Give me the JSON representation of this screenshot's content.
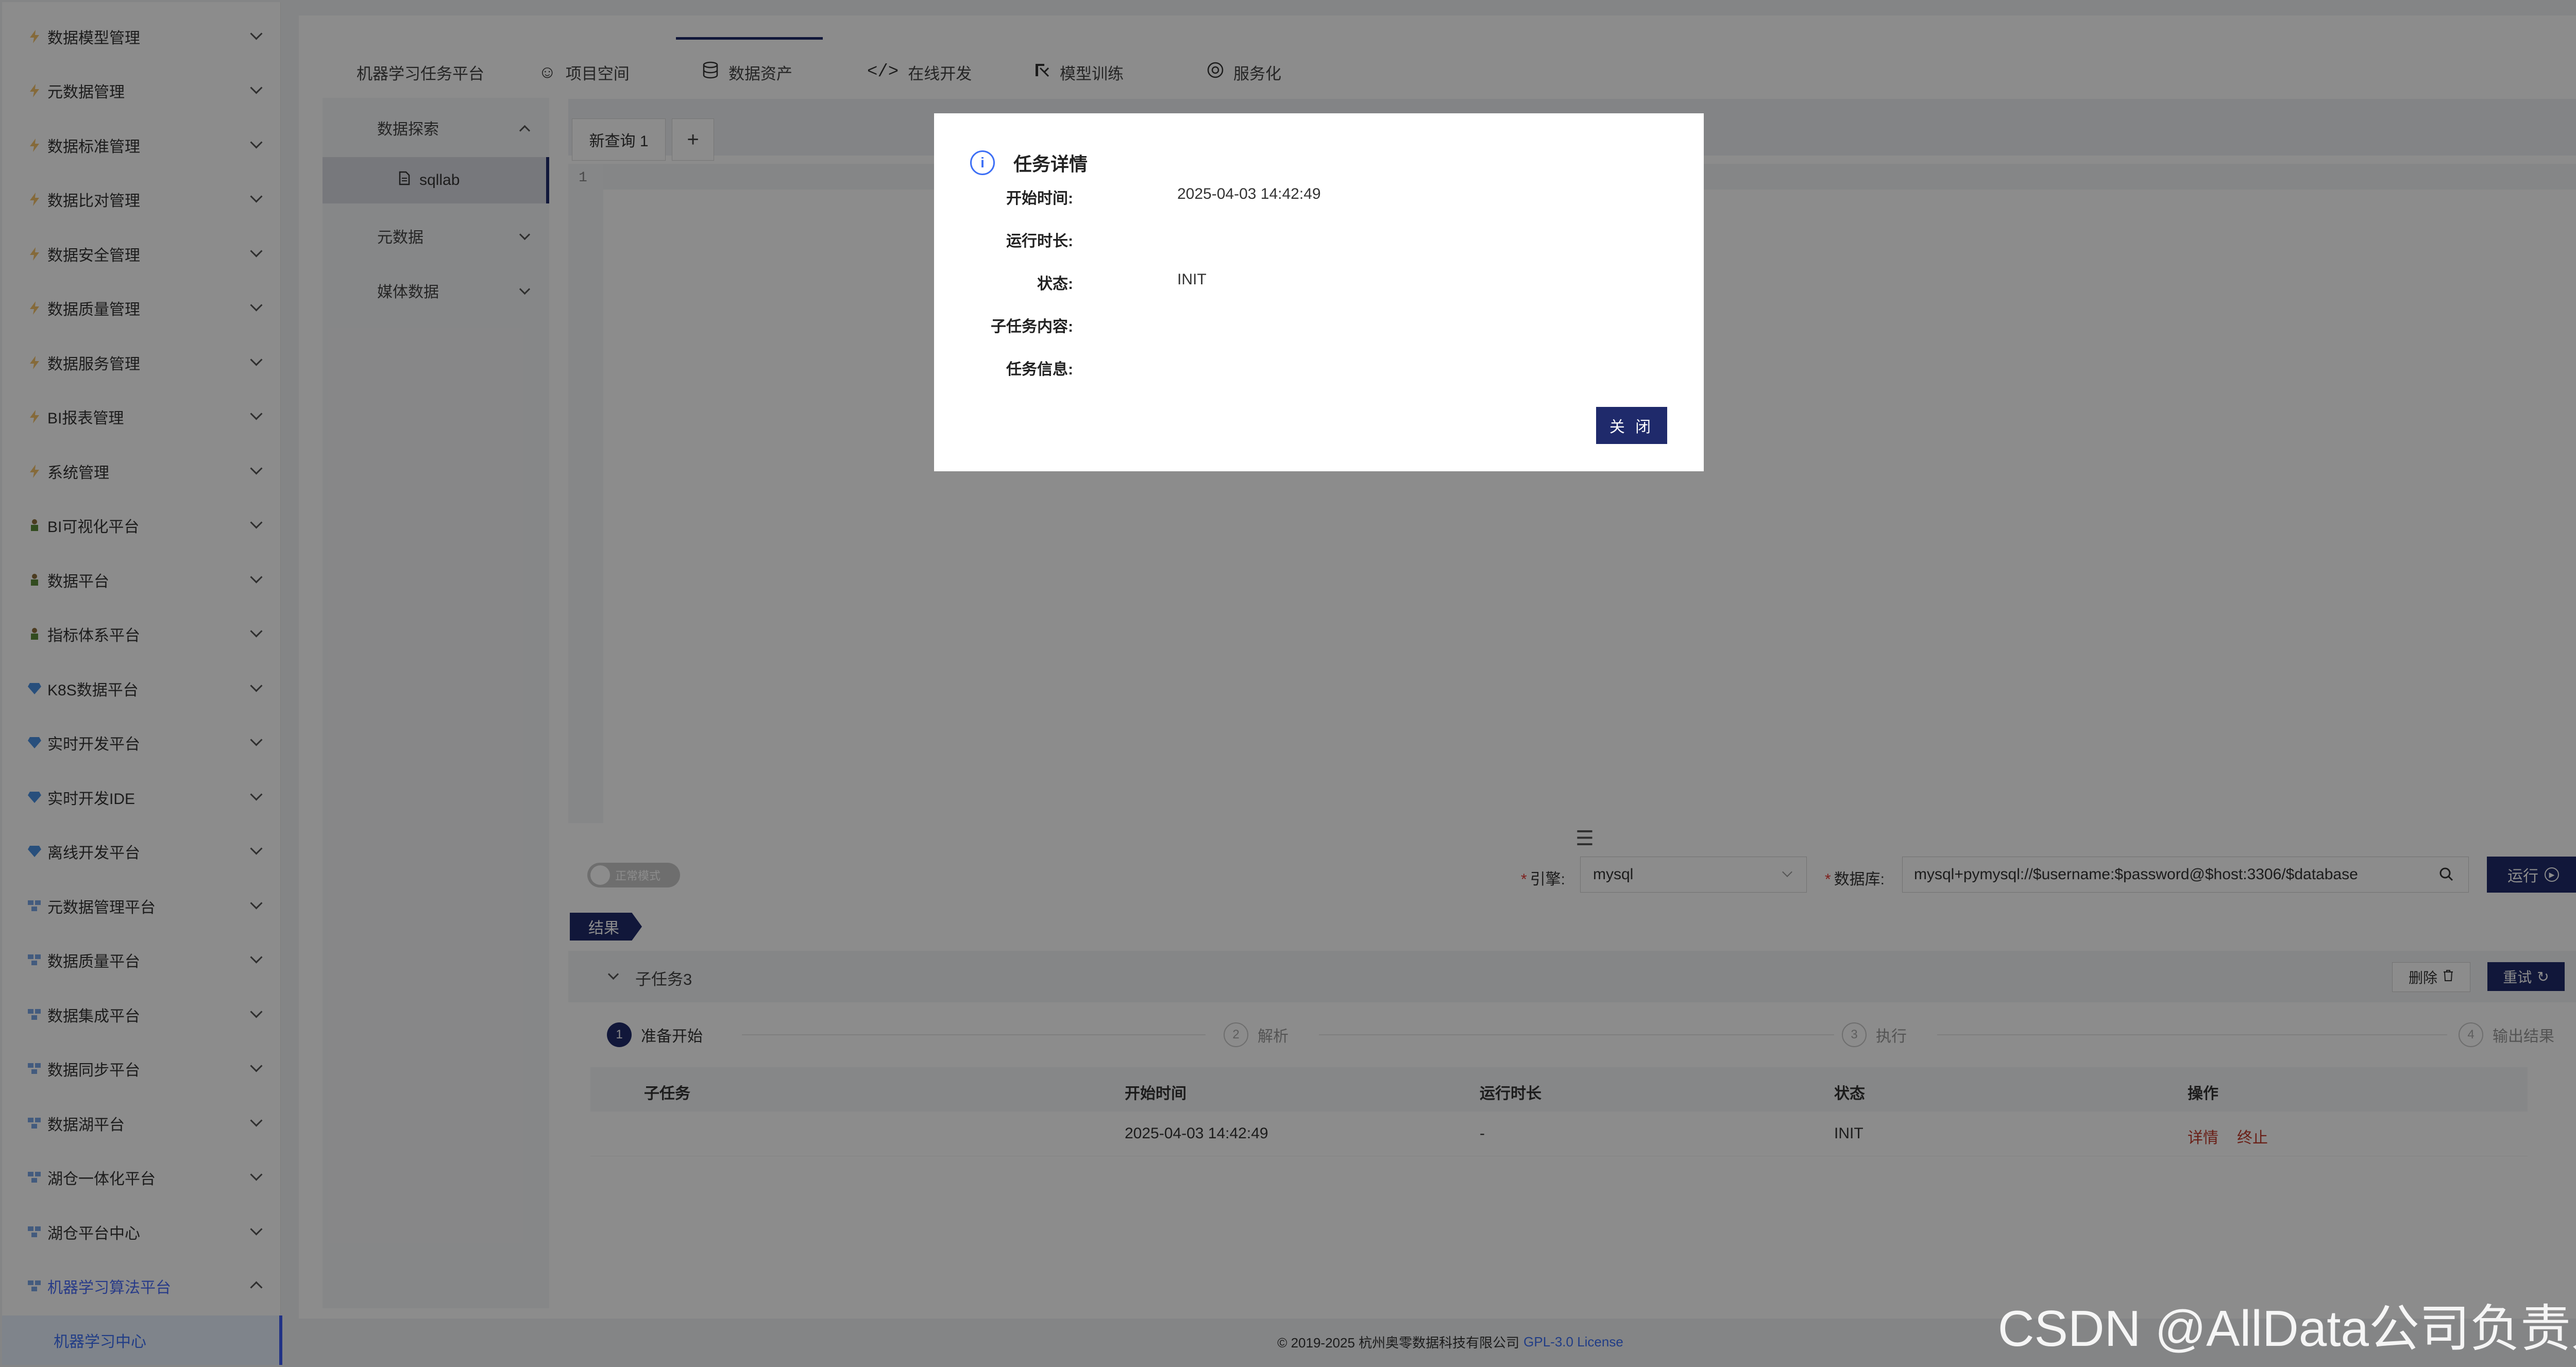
{
  "sidebar": {
    "items": [
      {
        "label": "数据模型管理",
        "icon": "bolt-icon"
      },
      {
        "label": "元数据管理",
        "icon": "bolt-icon"
      },
      {
        "label": "数据标准管理",
        "icon": "bolt-icon"
      },
      {
        "label": "数据比对管理",
        "icon": "bolt-icon"
      },
      {
        "label": "数据安全管理",
        "icon": "bolt-icon"
      },
      {
        "label": "数据质量管理",
        "icon": "bolt-icon"
      },
      {
        "label": "数据服务管理",
        "icon": "bolt-icon"
      },
      {
        "label": "BI报表管理",
        "icon": "bolt-icon"
      },
      {
        "label": "系统管理",
        "icon": "bolt-icon"
      },
      {
        "label": "BI可视化平台",
        "icon": "figure-icon"
      },
      {
        "label": "数据平台",
        "icon": "figure-icon"
      },
      {
        "label": "指标体系平台",
        "icon": "figure-icon"
      },
      {
        "label": "K8S数据平台",
        "icon": "gem-icon"
      },
      {
        "label": "实时开发平台",
        "icon": "gem-icon"
      },
      {
        "label": "实时开发IDE",
        "icon": "gem-icon"
      },
      {
        "label": "离线开发平台",
        "icon": "gem-icon"
      },
      {
        "label": "元数据管理平台",
        "icon": "cluster-icon"
      },
      {
        "label": "数据质量平台",
        "icon": "cluster-icon"
      },
      {
        "label": "数据集成平台",
        "icon": "cluster-icon"
      },
      {
        "label": "数据同步平台",
        "icon": "cluster-icon"
      },
      {
        "label": "数据湖平台",
        "icon": "cluster-icon"
      },
      {
        "label": "湖仓一体化平台",
        "icon": "cluster-icon"
      },
      {
        "label": "湖仓平台中心",
        "icon": "cluster-icon"
      },
      {
        "label": "机器学习算法平台",
        "icon": "cluster-icon"
      }
    ],
    "sub_active": "机器学习中心"
  },
  "topnav": {
    "brand": "机器学习任务平台",
    "tabs": [
      {
        "label": "项目空间",
        "icon": "people-icon"
      },
      {
        "label": "数据资产",
        "icon": "database-icon"
      },
      {
        "label": "在线开发",
        "icon": "code-icon"
      },
      {
        "label": "模型训练",
        "icon": "model-icon"
      },
      {
        "label": "服务化",
        "icon": "service-icon"
      }
    ],
    "active": "数据资产"
  },
  "submenu": {
    "explore": "数据探索",
    "sqllab": "sqllab",
    "metadata": "元数据",
    "media": "媒体数据"
  },
  "editor": {
    "query_tab": "新查询 1",
    "add_tab": "+",
    "line_number": "1"
  },
  "toolbar": {
    "toggle_label": "正常模式",
    "engine_label": "引擎:",
    "engine_value": "mysql",
    "db_label": "数据库:",
    "db_value": "mysql+pymysql://$username:$password@$host:3306/$database",
    "run_label": "运行"
  },
  "result": {
    "tag": "结果",
    "subtask_title": "子任务3",
    "delete_label": "删除",
    "retry_label": "重试",
    "steps": [
      {
        "num": "1",
        "label": "准备开始",
        "state": "done"
      },
      {
        "num": "2",
        "label": "解析",
        "state": "todo"
      },
      {
        "num": "3",
        "label": "执行",
        "state": "todo"
      },
      {
        "num": "4",
        "label": "输出结果",
        "state": "todo"
      }
    ],
    "columns": [
      "子任务",
      "开始时间",
      "运行时长",
      "状态",
      "操作"
    ],
    "rows": [
      {
        "subtask": "",
        "start": "2025-04-03 14:42:49",
        "duration": "-",
        "status": "INIT",
        "op_detail": "详情",
        "op_stop": "终止"
      }
    ]
  },
  "footer": {
    "copyright": "© 2019-2025 杭州奥零数据科技有限公司",
    "license": "GPL-3.0 License"
  },
  "watermark": "CSDN @AllData公司负责人",
  "modal": {
    "title": "任务详情",
    "fields": [
      {
        "key": "开始时间:",
        "value": "2025-04-03 14:42:49"
      },
      {
        "key": "运行时长:",
        "value": ""
      },
      {
        "key": "状态:",
        "value": "INIT"
      },
      {
        "key": "子任务内容:",
        "value": ""
      },
      {
        "key": "任务信息:",
        "value": ""
      }
    ],
    "close_label": "关 闭"
  },
  "colors": {
    "primary": "#1f2a6b",
    "accent": "#3d6ff5",
    "danger": "#c0392b"
  }
}
